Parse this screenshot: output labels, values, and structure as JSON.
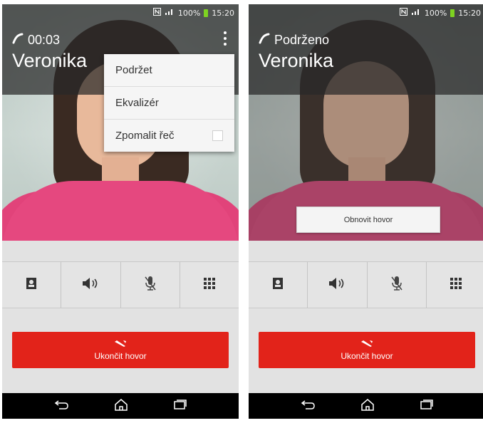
{
  "status": {
    "battery": "100%",
    "time": "15:20"
  },
  "left": {
    "call_state": "00:03",
    "caller_name": "Veronika",
    "menu": [
      {
        "label": "Podržet",
        "checkbox": false
      },
      {
        "label": "Ekvalizér",
        "checkbox": false
      },
      {
        "label": "Zpomalit řeč",
        "checkbox": true,
        "checked": false
      }
    ],
    "end_call_label": "Ukončit hovor"
  },
  "right": {
    "call_state": "Podrženo",
    "caller_name": "Veronika",
    "resume_label": "Obnovit hovor",
    "end_call_label": "Ukončit hovor"
  },
  "actions": [
    "contacts-icon",
    "speaker-icon",
    "mute-mic-icon",
    "dialpad-icon"
  ],
  "nav": [
    "back-icon",
    "home-icon",
    "recent-apps-icon"
  ],
  "colors": {
    "end_call": "#e2231a",
    "battery": "#7ed321",
    "shirt": "#e5487f"
  }
}
